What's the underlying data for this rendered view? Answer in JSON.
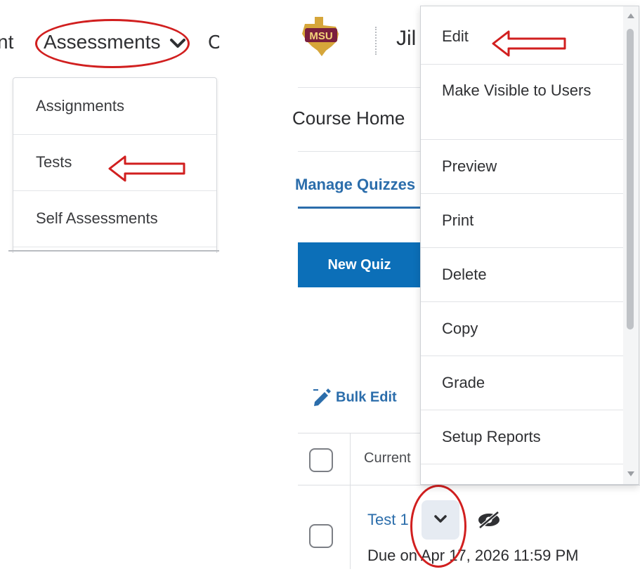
{
  "left_panel": {
    "nav_partial_left": "nt",
    "nav_assessments": "Assessments",
    "nav_partial_right": "C",
    "dropdown_items": [
      "Assignments",
      "Tests",
      "Self Assessments"
    ]
  },
  "header": {
    "logo_text": "MSU",
    "title_partial": "Jil"
  },
  "page": {
    "course_home": "Course Home",
    "manage_tab": "Manage Quizzes",
    "new_quiz_button": "New Quiz",
    "bulk_edit": "Bulk Edit",
    "column_current": "Current",
    "quiz_name": "Test 1",
    "due_text": "Due on Apr 17, 2026 11:59 PM"
  },
  "context_menu": {
    "items": [
      "Edit",
      "Make Visible to Users",
      "Preview",
      "Print",
      "Delete",
      "Copy",
      "Grade",
      "Setup Reports"
    ]
  },
  "colors": {
    "accent_blue": "#2b6dab",
    "button_blue": "#0c6fb8",
    "annotation_red": "#d11f1f"
  },
  "icons": [
    "chevron-down-icon",
    "pencil-icon",
    "hidden-eye-icon",
    "scroll-up-icon",
    "scroll-down-icon",
    "red-arrow-icon"
  ]
}
